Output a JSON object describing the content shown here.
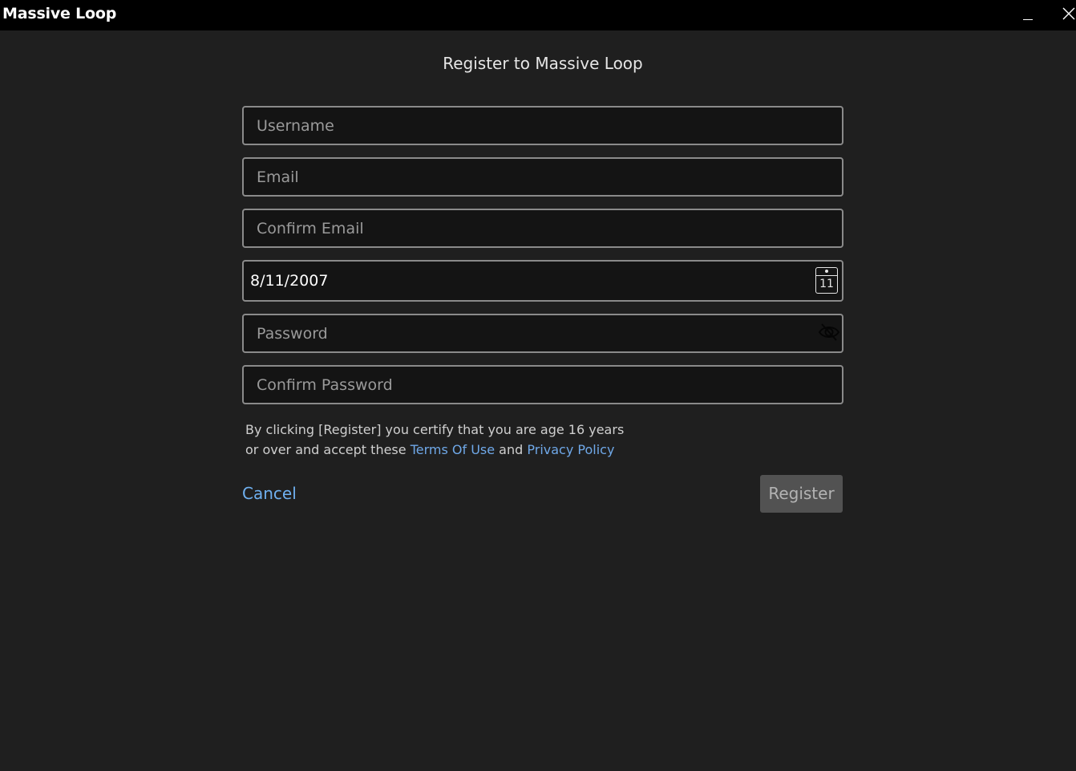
{
  "window": {
    "title": "Massive Loop",
    "minimize_icon": "minimize-icon",
    "close_icon": "close-icon"
  },
  "page": {
    "title": "Register to Massive Loop"
  },
  "form": {
    "username": {
      "placeholder": "Username",
      "value": ""
    },
    "email": {
      "placeholder": "Email",
      "value": ""
    },
    "confirm_email": {
      "placeholder": "Confirm Email",
      "value": ""
    },
    "birthdate": {
      "value": "8/11/2007",
      "calendar_day": "11",
      "icon": "calendar-icon"
    },
    "password": {
      "placeholder": "Password",
      "value": "",
      "icon": "eye-hidden-icon"
    },
    "confirm_password": {
      "placeholder": "Confirm Password",
      "value": ""
    }
  },
  "terms": {
    "text_before": "By clicking [Register] you certify that you are age 16 years or over and accept these ",
    "terms_link": "Terms Of Use",
    "text_between": " and ",
    "privacy_link": "Privacy Policy"
  },
  "actions": {
    "cancel_label": "Cancel",
    "register_label": "Register"
  },
  "colors": {
    "background": "#1f1f1f",
    "titlebar": "#000000",
    "link": "#6fa8e8",
    "field_border": "#8a8a8a",
    "register_disabled_bg": "#525252"
  }
}
